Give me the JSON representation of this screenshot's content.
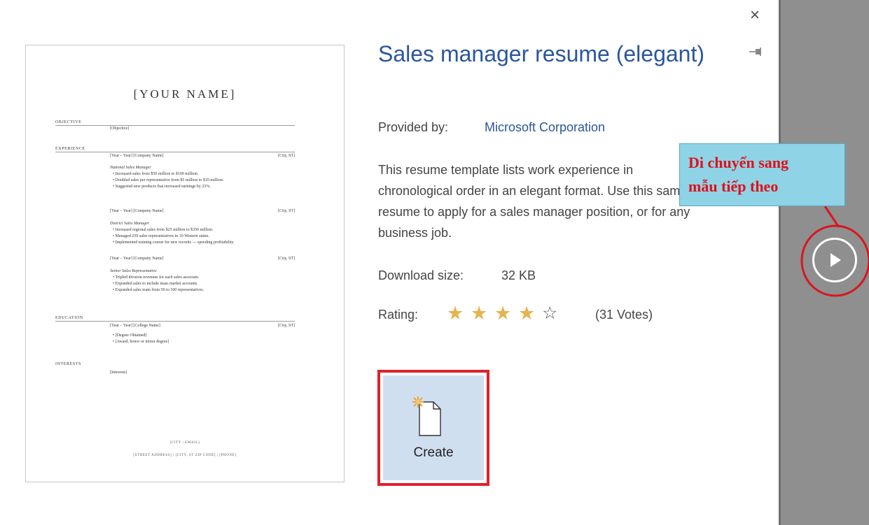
{
  "dialog": {
    "close_icon": "×",
    "pin_icon": "pin-icon"
  },
  "preview": {
    "name": "[YOUR NAME]",
    "sections": {
      "objective": "OBJECTIVE",
      "experience": "EXPERIENCE",
      "education": "EDUCATION",
      "interests": "INTERESTS"
    },
    "objective_text": "[Objective]",
    "jobs": [
      {
        "header": "[Year – Year]    [Company Name]",
        "location": "[City, ST]",
        "title": "National Sales Manager",
        "bullets": [
          "•  Increased sales from $50 million to $100 million.",
          "•  Doubled sales per representative from $5 million to $10 million.",
          "•  Suggested new products that increased earnings by 23%."
        ]
      },
      {
        "header": "[Year – Year]    [Company Name]",
        "location": "[City, ST]",
        "title": "District Sales Manager",
        "bullets": [
          "•  Increased regional sales from $25 million to $350 million.",
          "•  Managed 250 sales representatives in 10 Western states.",
          "•  Implemented training course for new recruits — speeding profitability."
        ]
      },
      {
        "header": "[Year – Year]    [Company Name]",
        "location": "[City, ST]",
        "title": "Senior Sales Representative",
        "bullets": [
          "•  Tripled division revenues for each sales associate.",
          "•  Expanded sales to include mass market accounts.",
          "•  Expanded sales team from 50 to 100 representatives."
        ]
      }
    ],
    "education": {
      "header": "[Year – Year]    [College Name]",
      "location": "[City, ST]",
      "bullets": [
        "•  [Degree Obtained]",
        "•  [Award, honor or minor degree]"
      ]
    },
    "interests_text": "[Interests]",
    "footer_1": "[CITY | EMAIL]",
    "footer_2": "[STREET ADDRESS] | [CITY, ST ZIP CODE] | [PHONE]"
  },
  "info": {
    "title": "Sales manager resume (elegant)",
    "provider_label": "Provided by:",
    "provider_name": "Microsoft Corporation",
    "description": "This resume template lists work experience in chronological order in an elegant format. Use this sample resume to apply for a sales manager position, or for any business job.",
    "download_label": "Download size:",
    "download_value": "32 KB",
    "rating_label": "Rating:",
    "rating_value": 4,
    "rating_max": 5,
    "votes": "(31 Votes)"
  },
  "create_button": {
    "label": "Create",
    "icon": "new-document-icon"
  },
  "navigation": {
    "next_icon": "play-arrow-icon"
  },
  "annotation": {
    "text": "Di chuyển sang\nmẫu tiếp theo"
  },
  "colors": {
    "accent_blue": "#2b579a",
    "star_gold": "#e6b34e",
    "highlight_red": "#e0202b",
    "create_bg": "#d0dff0",
    "side_gray": "#8f8f8f",
    "callout_bg": "#8fd3e6"
  }
}
